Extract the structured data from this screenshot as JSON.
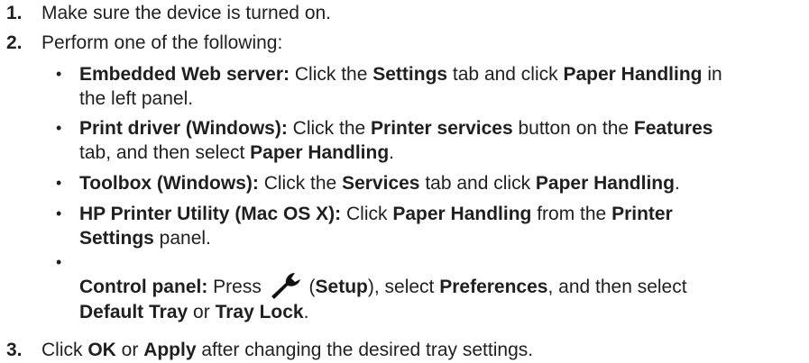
{
  "steps": [
    {
      "number": "1.",
      "text": "Make sure the device is turned on."
    },
    {
      "number": "2.",
      "text": "Perform one of the following:"
    },
    {
      "number": "3.",
      "parts": [
        "Click ",
        "OK",
        " or ",
        "Apply",
        " after changing the desired tray settings."
      ]
    }
  ],
  "bullet_glyph": "•",
  "options": {
    "ews": {
      "label": "Embedded Web server:",
      "t1": " Click the ",
      "b1": "Settings",
      "t2": " tab and click ",
      "b2": "Paper Handling",
      "t3": " in",
      "t4": "the left panel."
    },
    "driver": {
      "label": "Print driver (Windows):",
      "t1": " Click the ",
      "b1": "Printer services",
      "t2": " button on the ",
      "b2": "Features",
      "t3": "tab, and then select ",
      "b3": "Paper Handling",
      "t4": "."
    },
    "toolbox": {
      "label": "Toolbox (Windows):",
      "t1": " Click the ",
      "b1": "Services",
      "t2": " tab and click ",
      "b2": "Paper Handling",
      "t3": "."
    },
    "mac": {
      "label": "HP Printer Utility (Mac OS X):",
      "t1": " Click ",
      "b1": "Paper Handling",
      "t2": " from the ",
      "b2": "Printer",
      "b3": "Settings",
      "t3": " panel."
    },
    "control": {
      "label": "Control panel:",
      "t1": " Press ",
      "icon": "wrench-icon",
      "t2": " (",
      "b1": "Setup",
      "t3": "), select ",
      "b2": "Preferences",
      "t4": ", and then select",
      "b3": "Default Tray",
      "t5": " or ",
      "b4": "Tray Lock",
      "t6": "."
    }
  }
}
